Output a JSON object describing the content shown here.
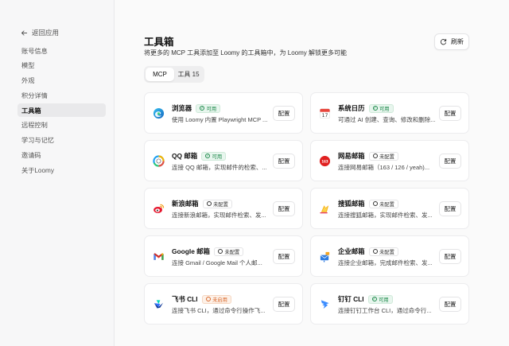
{
  "sidebar": {
    "back_label": "返回应用",
    "items": [
      {
        "label": "账号信息",
        "active": false
      },
      {
        "label": "模型",
        "active": false
      },
      {
        "label": "外观",
        "active": false
      },
      {
        "label": "积分详情",
        "active": false
      },
      {
        "label": "工具箱",
        "active": true
      },
      {
        "label": "远程控制",
        "active": false
      },
      {
        "label": "学习与记忆",
        "active": false
      },
      {
        "label": "邀请码",
        "active": false
      },
      {
        "label": "关于Loomy",
        "active": false
      }
    ]
  },
  "header": {
    "title": "工具箱",
    "subtitle": "将更多的 MCP 工具添加至 Loomy 的工具箱中，为 Loomy 解锁更多可能",
    "refresh_label": "刷新"
  },
  "tabs": [
    {
      "label": "MCP",
      "active": true
    },
    {
      "label": "工具 15",
      "active": false
    }
  ],
  "tools": [
    {
      "name": "浏览器",
      "status": "可用",
      "status_type": "ok",
      "desc": "使用 Loomy 内置 Playwright MCP ...",
      "icon": "edge-browser-icon",
      "config_label": "配置"
    },
    {
      "name": "系统日历",
      "status": "可用",
      "status_type": "ok",
      "desc": "可通过 AI 创建、查询、修改和删除...",
      "icon": "calendar-icon",
      "config_label": "配置"
    },
    {
      "name": "QQ 邮箱",
      "status": "可用",
      "status_type": "ok",
      "desc": "连接 QQ 邮箱，实现邮件的检索、...",
      "icon": "qq-mail-icon",
      "config_label": "配置"
    },
    {
      "name": "网易邮箱",
      "status": "未配置",
      "status_type": "off",
      "desc": "连接网易邮箱（163 / 126 / yeah)...",
      "icon": "netease-mail-icon",
      "config_label": "配置"
    },
    {
      "name": "新浪邮箱",
      "status": "未配置",
      "status_type": "off",
      "desc": "连接新浪邮箱，实现邮件检索、发...",
      "icon": "sina-mail-icon",
      "config_label": "配置"
    },
    {
      "name": "搜狐邮箱",
      "status": "未配置",
      "status_type": "off",
      "desc": "连接搜狐邮箱，实现邮件检索、发...",
      "icon": "sohu-mail-icon",
      "config_label": "配置"
    },
    {
      "name": "Google 邮箱",
      "status": "未配置",
      "status_type": "off",
      "desc": "连接 Gmail / Google Mail 个人邮...",
      "icon": "gmail-icon",
      "config_label": "配置"
    },
    {
      "name": "企业邮箱",
      "status": "未配置",
      "status_type": "off",
      "desc": "连接企业邮箱，完成邮件检索、发...",
      "icon": "enterprise-mail-icon",
      "config_label": "配置"
    },
    {
      "name": "飞书 CLI",
      "status": "未启用",
      "status_type": "dis",
      "desc": "连接飞书 CLI，通过命令行操作飞...",
      "icon": "feishu-icon",
      "config_label": "配置"
    },
    {
      "name": "钉钉 CLI",
      "status": "可用",
      "status_type": "ok",
      "desc": "连接钉钉工作台 CLI，通过命令行...",
      "icon": "dingtalk-icon",
      "config_label": "配置"
    }
  ]
}
